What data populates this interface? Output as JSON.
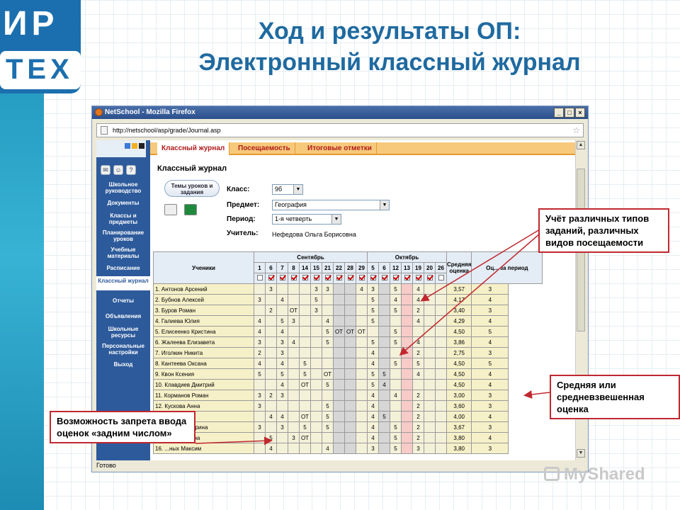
{
  "slide": {
    "title_line1": "Ход и результаты ОП:",
    "title_line2": "Электронный классный журнал",
    "logo_top": "ИР",
    "logo_bottom": "ТЕХ"
  },
  "browser": {
    "window_title": "NetSchool - Mozilla Firefox",
    "url": "http://netschool/asp/grade/Journal.asp",
    "status": "Готово"
  },
  "sidebar": {
    "items": [
      "Школьное руководство",
      "Документы",
      "Классы и предметы",
      "Планирование уроков",
      "Учебные материалы",
      "Расписание",
      "Классный журнал",
      "Отчеты",
      "Объявления",
      "Школьные ресурсы",
      "Персональные настройки",
      "Выход"
    ],
    "active_index": 6
  },
  "tabs": [
    "Классный журнал",
    "Посещаемость",
    "Итоговые отметки"
  ],
  "journal": {
    "heading": "Классный журнал",
    "topics_button": "Темы уроков и задания",
    "fields": {
      "class_label": "Класс:",
      "class_value": "9б",
      "subject_label": "Предмет:",
      "subject_value": "География",
      "period_label": "Период:",
      "period_value": "1-я четверть",
      "teacher_label": "Учитель:",
      "teacher_value": "Нефедова Ольга Борисовна"
    }
  },
  "table": {
    "students_header": "Ученики",
    "month1": "Сентябрь",
    "month2": "Октябрь",
    "avg_header": "Средняя оценка",
    "period_header": "Оц... за период",
    "days_sept": [
      "1",
      "6",
      "7",
      "8",
      "14",
      "15",
      "21",
      "22",
      "28",
      "29"
    ],
    "days_oct": [
      "5",
      "6",
      "12",
      "13",
      "19",
      "20",
      "26",
      "27"
    ],
    "rows": [
      {
        "name": "1. Антонов Арсений",
        "g": [
          "",
          "3",
          "",
          "",
          "",
          "3",
          "3",
          "",
          "",
          "4",
          "3",
          "",
          "5",
          "",
          "4",
          "",
          ""
        ],
        "avg": "3,57",
        "period": "3"
      },
      {
        "name": "2. Бубнов Алексей",
        "g": [
          "3",
          "",
          "4",
          "",
          "",
          "5",
          "",
          "",
          "",
          "",
          "5",
          "",
          "4",
          "",
          "4",
          "",
          ""
        ],
        "avg": "4,17",
        "period": "4"
      },
      {
        "name": "3. Буров Роман",
        "g": [
          "",
          "2",
          "",
          "ОТ",
          "",
          "3",
          "",
          "",
          "",
          "",
          "5",
          "",
          "5",
          "",
          "2",
          "",
          ""
        ],
        "avg": "3,40",
        "period": "3"
      },
      {
        "name": "4. Галиева Юлия",
        "g": [
          "4",
          "",
          "5",
          "3",
          "",
          "",
          "4",
          "",
          "",
          "",
          "5",
          "",
          "",
          "",
          "4",
          "",
          ""
        ],
        "avg": "4,29",
        "period": "4"
      },
      {
        "name": "5. Елисеенко Кристина",
        "g": [
          "4",
          "",
          "4",
          "",
          "",
          "",
          "5",
          "ОТ",
          "ОТ",
          "ОТ",
          "",
          "",
          "5",
          "",
          "",
          "",
          ""
        ],
        "avg": "4,50",
        "period": "5"
      },
      {
        "name": "6. Жалеева Елизавета",
        "g": [
          "3",
          "",
          "3",
          "4",
          "",
          "",
          "5",
          "",
          "",
          "",
          "5",
          "",
          "5",
          "",
          "4",
          "",
          ""
        ],
        "avg": "3,86",
        "period": "4"
      },
      {
        "name": "7. Иголкин Никита",
        "g": [
          "2",
          "",
          "3",
          "",
          "",
          "",
          "",
          "",
          "",
          "",
          "4",
          "",
          "",
          "",
          "2",
          "",
          ""
        ],
        "avg": "2,75",
        "period": "3"
      },
      {
        "name": "8. Кантеева Оксана",
        "g": [
          "4",
          "",
          "4",
          "",
          "5",
          "",
          "",
          "",
          "",
          "",
          "4",
          "",
          "5",
          "",
          "5",
          "",
          ""
        ],
        "avg": "4,50",
        "period": "5"
      },
      {
        "name": "9. Квон Ксения",
        "g": [
          "5",
          "",
          "5",
          "",
          "5",
          "",
          "ОТ",
          "",
          "",
          "",
          "5",
          "5",
          "",
          "",
          "4",
          "",
          ""
        ],
        "avg": "4,50",
        "period": "4"
      },
      {
        "name": "10. Клавдиев Дмитрий",
        "g": [
          "",
          "",
          "4",
          "",
          "ОТ",
          "",
          "5",
          "",
          "",
          "",
          "5",
          "4",
          "",
          "",
          "",
          "",
          ""
        ],
        "avg": "4,50",
        "period": "4"
      },
      {
        "name": "11. Корманов Роман",
        "g": [
          "3",
          "2",
          "3",
          "",
          "",
          "",
          "",
          "",
          "",
          "",
          "4",
          "",
          "4",
          "",
          "2",
          "",
          ""
        ],
        "avg": "3,00",
        "period": "3"
      },
      {
        "name": "12. Кускова Анна",
        "g": [
          "3",
          "",
          "",
          "",
          "",
          "",
          "5",
          "",
          "",
          "",
          "4",
          "",
          "",
          "",
          "2",
          "",
          ""
        ],
        "avg": "3,60",
        "period": "3"
      },
      {
        "name": "13. ... Ксения",
        "g": [
          "",
          "4",
          "4",
          "",
          "ОТ",
          "",
          "5",
          "",
          "",
          "",
          "4",
          "5",
          "",
          "",
          "2",
          "",
          ""
        ],
        "avg": "4,00",
        "period": "4"
      },
      {
        "name": "14. ...ова Екатерина",
        "g": [
          "3",
          "",
          "3",
          "",
          "5",
          "",
          "5",
          "",
          "",
          "",
          "4",
          "",
          "5",
          "",
          "2",
          "",
          ""
        ],
        "avg": "3,67",
        "period": "3"
      },
      {
        "name": "15. ...ева Полина",
        "g": [
          "",
          "5",
          "",
          "3",
          "ОТ",
          "",
          "",
          "",
          "",
          "",
          "4",
          "",
          "5",
          "",
          "2",
          "",
          ""
        ],
        "avg": "3,80",
        "period": "4"
      },
      {
        "name": "16. ...ных Максим",
        "g": [
          "",
          "4",
          "",
          "",
          "",
          "",
          "4",
          "",
          "",
          "",
          "3",
          "",
          "5",
          "",
          "3",
          "",
          ""
        ],
        "avg": "3,80",
        "period": "3"
      }
    ]
  },
  "callouts": {
    "types": "Учёт различных типов заданий, различных видов посещаемости",
    "average": "Средняя или средневзвешенная оценка",
    "backdate": "Возможность запрета ввода оценок «задним числом»"
  },
  "watermark": "MyShared",
  "colors": {
    "title": "#1f6aa0",
    "callout_border": "#c0282f",
    "sidebar": "#2d5a9b"
  }
}
